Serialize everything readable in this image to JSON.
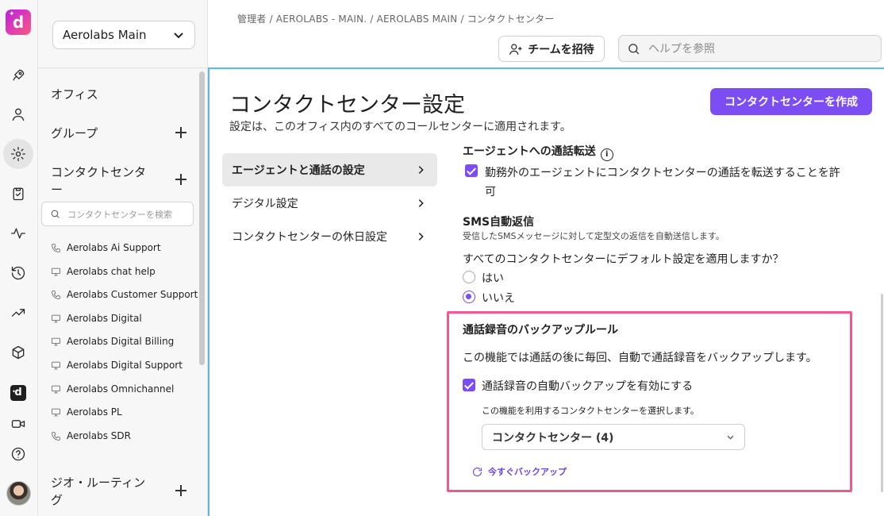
{
  "rail": {
    "icons": [
      "rocket-icon",
      "user-icon",
      "gear-icon",
      "clipboard-icon",
      "activity-icon",
      "history-icon",
      "trending-icon",
      "cube-icon",
      "dialpad-logo-icon",
      "video-icon",
      "help-icon"
    ],
    "logo_letter": "d",
    "app_badge_letter": "d"
  },
  "sidebar": {
    "office_select": "Aerolabs Main",
    "items": [
      {
        "label": "オフィス"
      },
      {
        "label": "グループ"
      },
      {
        "label": "コンタクトセンタ",
        "label2": "ー"
      },
      {
        "label": "ジオ・ルーティン",
        "label2": "グ"
      }
    ],
    "search_placeholder": "コンタクトセンターを検索",
    "contact_centers": [
      {
        "name": "Aerolabs Ai Support",
        "icon": "phone-icon"
      },
      {
        "name": "Aerolabs chat help",
        "icon": "monitor-icon"
      },
      {
        "name": "Aerolabs Customer Support",
        "icon": "phone-icon"
      },
      {
        "name": "Aerolabs Digital",
        "icon": "monitor-icon"
      },
      {
        "name": "Aerolabs Digital Billing",
        "icon": "monitor-icon"
      },
      {
        "name": "Aerolabs Digital Support",
        "icon": "monitor-icon"
      },
      {
        "name": "Aerolabs Omnichannel",
        "icon": "monitor-icon"
      },
      {
        "name": "Aerolabs PL",
        "icon": "monitor-icon"
      },
      {
        "name": "Aerolabs SDR",
        "icon": "phone-icon"
      }
    ]
  },
  "header": {
    "breadcrumb": "管理者 / AEROLABS - MAIN. / AEROLABS MAIN / コンタクトセンター",
    "invite_label": "チームを招待",
    "help_placeholder": "ヘルプを参照"
  },
  "main": {
    "title": "コンタクトセンター設定",
    "subtitle": "設定は、このオフィス内のすべてのコールセンターに適用されます。",
    "create_label": "コンタクトセンターを作成",
    "sub_nav": [
      {
        "label": "エージェントと通話の設定",
        "active": true
      },
      {
        "label": "デジタル設定",
        "active": false
      },
      {
        "label": "コンタクトセンターの休日設定",
        "active": false
      }
    ],
    "transfer": {
      "title": "エージェントへの通話転送",
      "checkbox_line1": "勤務外のエージェントにコンタクトセンターの通話を転送することを許",
      "checkbox_line2": "可",
      "checked": true
    },
    "sms": {
      "title": "SMS自動返信",
      "description": "受信したSMSメッセージに対して定型文の返信を自動送信します。",
      "question": "すべてのコンタクトセンターにデフォルト設定を適用しますか？",
      "options": [
        "はい",
        "いいえ"
      ],
      "selected": "いいえ"
    },
    "backup": {
      "title": "通話録音のバックアップルール",
      "description": "この機能では通話の後に毎回、自動で通話録音をバックアップします。",
      "checkbox_label": "通話録音の自動バックアップを有効にする",
      "checked": true,
      "select_hint": "この機能を利用するコンタクトセンターを選択します。",
      "select_value": "コンタクトセンター (4)",
      "backup_now": "今すぐバックアップ"
    }
  },
  "colors": {
    "accent": "#7b4df2",
    "highlight": "#f2588c",
    "panel_border": "#5fb4ea"
  }
}
